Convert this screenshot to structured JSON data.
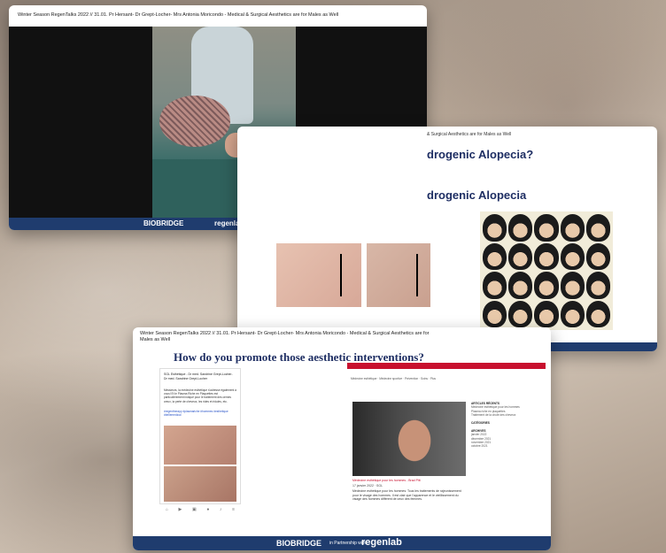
{
  "card1": {
    "title": "Winter Season RegenTalks 2022 // 31.01. Pr Hersant- Dr Grept-Locher- Mrs Antonia Moricondo - Medical & Surgical Aesthetics are for Males as Well",
    "footer_brand": "BIOBRIDGE",
    "footer_partner": "regenlab"
  },
  "card2": {
    "title_fragment": "& Surgical Aesthetics are for Males as Well",
    "question_fragment": "drogenic Alopecia?",
    "heading_fragment": "drogenic Alopecia"
  },
  "card3": {
    "title": "Winter Season RegenTalks 2022 // 31.01. Pr Hersant- Dr Grept-Locher- Mrs Antonia Moricondo - Medical & Surgical Aesthetics are for Males as Well",
    "heading": "How do you promote those aesthetic interventions?",
    "facebook": {
      "header": "SGL Esthétique - Dr med. Sandrine Grept-Locher- Dr med. Sandrine Grept-Locher",
      "body": "Messieurs, la médecine esthétique s'adresse également à vous! Et le Plasma Riche en Plaquettes est particulièrement indiqué pour le traitement des cernes creux, la perte de cheveux, les rides et ridules, etc.",
      "tags": "#regentherapy #plasmariche #hommes #esthetique #bellemedical",
      "nav": [
        "Home",
        "Watch",
        "Marketplace",
        "Profile",
        "Notifications",
        "Menu"
      ]
    },
    "website": {
      "menu": "Médecine esthétique · Médecine sportive · Prévention · Soins · Plus",
      "caption": "Médecine esthétique pour les hommes - Brad Pitt",
      "date": "17 janvier 2022 · SGL",
      "article": "Médecine esthétique pour les hommes: Tous les traitements de rajeunissement pour le visage des hommes. Il est clair que l'apparence et le vieillissement du visage des hommes diffèrent de ceux des femmes.",
      "sidebar_title1": "ARTICLES RÉCENTS",
      "sidebar_items1": [
        "Médecine esthétique pour les hommes",
        "Plasma riche en plaquettes",
        "Traitement de la chute des cheveux"
      ],
      "sidebar_title2": "CATÉGORIES",
      "sidebar_title3": "ARCHIVES",
      "sidebar_items3": [
        "janvier 2022",
        "décembre 2021",
        "novembre 2021",
        "octobre 2021"
      ]
    },
    "footer_brand": "BIOBRIDGE",
    "footer_partner": "in Partnership with",
    "footer_regen": "regenlab"
  }
}
